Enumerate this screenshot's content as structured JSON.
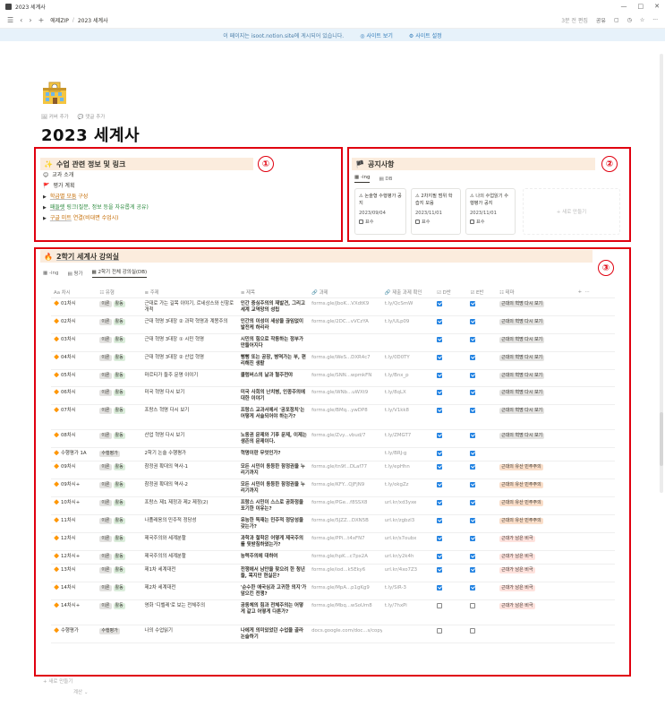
{
  "window": {
    "title": "2023 세계사",
    "controls": [
      "—",
      "□",
      "✕"
    ]
  },
  "nav": {
    "crumb1": "에제ZIP",
    "crumb2": "2023 세계사",
    "edited": "3분 전 편집",
    "share": "공유"
  },
  "banner": {
    "text": "이 페이지는 isoot.notion.site에 게시되어 있습니다.",
    "view": "사이트 보기",
    "settings": "사이트 설정"
  },
  "page": {
    "add_cover": "커버 추가",
    "add_comment": "댓글 추가",
    "title": "2023 세계사"
  },
  "sec1": {
    "header": "수업 관련 정보 및 링크",
    "items": [
      "교과 소개",
      "평가 계획"
    ],
    "toggles": [
      {
        "u": "학급별 모둠",
        "rest": " 구성"
      },
      {
        "u": "패들렛",
        "rest": " 링크(질문, 정보 등을 자유롭게 공유)"
      },
      {
        "u": "구글 미트",
        "rest": " 연결(비대면 수업시)"
      }
    ]
  },
  "sec2": {
    "header": "공지사항",
    "tabs": [
      "-ing",
      "DB"
    ],
    "cards": [
      {
        "title": "논술형 수행평가 공지",
        "date": "2023/09/04",
        "label": "표수"
      },
      {
        "title": "2차지필 범위 학습지 모음",
        "date": "2023/11/01",
        "label": "표수"
      },
      {
        "title": "나의 수업읽기 수행평가 공지",
        "date": "2023/11/01",
        "label": "표수"
      }
    ],
    "new_card": "+ 새로 만들기"
  },
  "sec3": {
    "header": "2학기 세계사 강의실",
    "tabs": [
      "-ing",
      "평가",
      "2학기 전체 강의실(DB)"
    ],
    "columns": [
      "차시",
      "유형",
      "주제",
      "제목",
      "과제",
      "제출 과제 확인",
      "D반",
      "E반",
      "테마"
    ],
    "rows": [
      {
        "n": "01차시",
        "type": [
          "이론",
          "활동"
        ],
        "topic": "근대로 가는 길목 이야기, 르네상스와 신항로 개척",
        "title": "인간 중심주의의 재발견, 그리고 세계 교역망의 성립",
        "link": "forms.gle/JboK...VXdtK9",
        "sub": "t.ly/QcSmW",
        "d": true,
        "e": true,
        "theme": "근대의 혁명 다시 보기",
        "tc": ""
      },
      {
        "n": "02차시",
        "type": [
          "이론",
          "활동"
        ],
        "topic": "근대 혁명 3대장 ② 과학 혁명과 계몽주의",
        "title": "인간의 이성이 세상을 끊임없이 발전케 하리라",
        "link": "forms.gle/2DC...vVCzYA",
        "sub": "t.ly/ULp09",
        "d": true,
        "e": true,
        "theme": "근대의 혁명 다시 보기",
        "tc": ""
      },
      {
        "n": "03차시",
        "type": [
          "이론",
          "활동"
        ],
        "topic": "근대 혁명 3대장 ① 시민 혁명",
        "title": "시민의 힘으로 작동하는 정부가 만들어지다",
        "link": "",
        "sub": "",
        "d": true,
        "e": true,
        "theme": "근대의 혁명 다시 보기",
        "tc": ""
      },
      {
        "n": "04차시",
        "type": [
          "이론",
          "활동"
        ],
        "topic": "근대 혁명 3대장 ② 산업 혁명",
        "title": "뻥뻥 또는 공장, 병역가는 부, 편리해진 생활",
        "link": "forms.gle/WeS...DXR4c7",
        "sub": "t.ly/0D0TY",
        "d": true,
        "e": true,
        "theme": "근대의 혁명 다시 보기",
        "tc": ""
      },
      {
        "n": "05차시",
        "type": [
          "이론",
          "활동"
        ],
        "topic": "마르티가 들주 문명 이야기",
        "title": "콜럼버스의 날과 혈주전야",
        "link": "forms.gle/SNN...wpmkFN",
        "sub": "t.ly/Bnx_p",
        "d": true,
        "e": true,
        "theme": "근대의 혁명 다시 보기",
        "tc": ""
      },
      {
        "n": "06차시",
        "type": [
          "이론",
          "활동"
        ],
        "topic": "미국 혁명 다시 보기",
        "title": "미국 사회의 난치병, 인종주의에 대한 이야기",
        "link": "forms.gle/WNb...uWXt9",
        "sub": "t.ly/8qLX",
        "d": true,
        "e": true,
        "theme": "근대의 혁명 다시 보기",
        "tc": ""
      },
      {
        "n": "07차시",
        "type": [
          "이론",
          "활동"
        ],
        "topic": "프랑스 혁명 다시 보기",
        "title": "프랑스 교과서에서 '공포정치'는 어떻게 서술되어야 하는가?",
        "link": "forms.gle/BMq...ywDP8",
        "sub": "t.ly/V1kk8",
        "d": true,
        "e": true,
        "theme": "근대의 혁명 다시 보기",
        "tc": ""
      },
      {
        "n": "08차시",
        "type": [
          "이론",
          "활동"
        ],
        "topic": "산업 혁명 다시 보기",
        "title": "노동권 문제와 기후 문제, 이제는 생존의 문제이다.",
        "link": "forms.gle/Zvy...vbud/7",
        "sub": "t.ly/ZMGT7",
        "d": true,
        "e": true,
        "theme": "근대의 혁명 다시 보기",
        "tc": ""
      },
      {
        "n": "수행평가 1A",
        "type": [
          "수행평가"
        ],
        "topic": "2학기 논술 수행평가",
        "title": "혁명이란 무엇인가?",
        "link": "",
        "sub": "t.ly/BRJ-g",
        "d": true,
        "e": true,
        "theme": "",
        "tc": ""
      },
      {
        "n": "09차시",
        "type": [
          "이론",
          "활동"
        ],
        "topic": "참정권 확대의 역사-1",
        "title": "모든 시민이 동등한 참정권을 누리기까지",
        "link": "forms.gle/tn9f...DLaf77",
        "sub": "t.ly/epHhn",
        "d": true,
        "e": true,
        "theme": "근대의 유산 민주주의",
        "tc": "org"
      },
      {
        "n": "09차시+",
        "type": [
          "이론",
          "활동"
        ],
        "topic": "참정권 확대의 역사-2",
        "title": "모든 시민이 동등한 참정권을 누리기까지",
        "link": "forms.gle/KFY...QJFjN9",
        "sub": "t.ly/okgZz",
        "d": true,
        "e": true,
        "theme": "근대의 유산 민주주의",
        "tc": "org"
      },
      {
        "n": "10차시+",
        "type": [
          "이론",
          "활동"
        ],
        "topic": "프랑스 제1 제정과 제2 제정(2)",
        "title": "프랑스 시민이 스스로 공화정을 포기한 이유는?",
        "link": "forms.gle/PGe...f8SSX8",
        "sub": "url.kr/xd3yxe",
        "d": true,
        "e": true,
        "theme": "근대의 유산 민주주의",
        "tc": "org"
      },
      {
        "n": "11차시",
        "type": [
          "이론",
          "활동"
        ],
        "topic": "나폴레옹의 민주적 정당성",
        "title": "유능한 독재는 민주적 정당성을 갖는가?",
        "link": "forms.gle/5JZZ...DXN5B",
        "sub": "url.kr/zgbzl3",
        "d": true,
        "e": true,
        "theme": "근대의 유산 민주주의",
        "tc": "org"
      },
      {
        "n": "12차시",
        "type": [
          "이론",
          "활동"
        ],
        "topic": "제국주의와 세계분할",
        "title": "과학과 철학은 어떻게 제국주의를 뒷받침하였는가?",
        "link": "forms.gle/PPi...t4xFN7",
        "sub": "url.kr/s7oubx",
        "d": true,
        "e": true,
        "theme": "근대가 남은 비극",
        "tc": "red"
      },
      {
        "n": "12차시+",
        "type": [
          "이론",
          "활동"
        ],
        "topic": "제국주의의 세계분할",
        "title": "능력주의에 대하여",
        "link": "forms.gle/hpK...c7px2A",
        "sub": "url.kr/y2k4h",
        "d": true,
        "e": true,
        "theme": "근대가 남은 비극",
        "tc": "red"
      },
      {
        "n": "13차시",
        "type": [
          "이론",
          "활동"
        ],
        "topic": "제1차 세계대전",
        "title": "전쟁에서 남만을 찾으려 한 청년들, 목지만 현실은?",
        "link": "forms.gle/iod...k5Eky6",
        "sub": "url.kr/4xo7Z3",
        "d": true,
        "e": true,
        "theme": "근대가 남은 비극",
        "tc": "red"
      },
      {
        "n": "14차시",
        "type": [
          "이론",
          "활동"
        ],
        "topic": "제2차 세계대전",
        "title": "'순수한 애국심과 고귀한 의지'가 앞으킨 전쟁?",
        "link": "forms.gle/MpA...p1gKg9",
        "sub": "t.ly/SiR-3",
        "d": true,
        "e": true,
        "theme": "근대가 남은 비극",
        "tc": "red"
      },
      {
        "n": "14차시+",
        "type": [
          "이론",
          "활동"
        ],
        "topic": "영화 '디벨레'로 보는 전체주의",
        "title": "공동체의 힘과 전체주의는 어떻게 같고 어떻게 다른가?",
        "link": "forms.gle/Mbq...wSoUm8",
        "sub": "t.ly/7hxPi",
        "d": false,
        "e": false,
        "theme": "근대가 남은 비극",
        "tc": "red"
      },
      {
        "n": "수행평가",
        "type": [
          "수행평가"
        ],
        "topic": "나의 수업읽기",
        "title": "나에게 의미있었던 수업을 골라 논술하기",
        "link": "docs.google.com/doc...s/copy",
        "sub": "",
        "d": false,
        "e": false,
        "theme": "",
        "tc": ""
      }
    ]
  },
  "footer": {
    "new": "+ 새로 만들기",
    "calc": "계산 ⌄"
  }
}
